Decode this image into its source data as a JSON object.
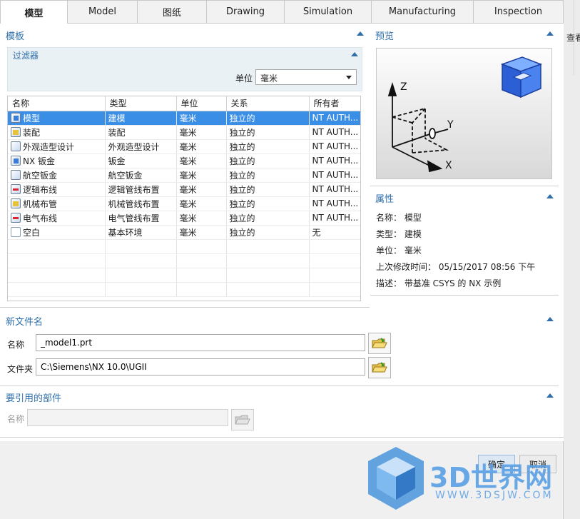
{
  "tabs": [
    "模型",
    "Model",
    "图纸",
    "Drawing",
    "Simulation",
    "Manufacturing",
    "Inspection"
  ],
  "right_strip_text": "查看",
  "templates": {
    "title": "模板",
    "filter": {
      "title": "过滤器",
      "unit_label": "单位",
      "unit_value": "毫米"
    },
    "columns": [
      "名称",
      "类型",
      "单位",
      "关系",
      "所有者"
    ],
    "rows": [
      {
        "name": "模型",
        "type": "建模",
        "unit": "毫米",
        "relation": "独立的",
        "owner": "NT AUTH...",
        "icon": "model-icon"
      },
      {
        "name": "装配",
        "type": "装配",
        "unit": "毫米",
        "relation": "独立的",
        "owner": "NT AUTH...",
        "icon": "assembly-icon"
      },
      {
        "name": "外观造型设计",
        "type": "外观造型设计",
        "unit": "毫米",
        "relation": "独立的",
        "owner": "NT AUTH...",
        "icon": "shape-studio-icon"
      },
      {
        "name": "NX 钣金",
        "type": "钣金",
        "unit": "毫米",
        "relation": "独立的",
        "owner": "NT AUTH...",
        "icon": "sheet-metal-icon"
      },
      {
        "name": "航空钣金",
        "type": "航空钣金",
        "unit": "毫米",
        "relation": "独立的",
        "owner": "NT AUTH...",
        "icon": "aero-sheet-metal-icon"
      },
      {
        "name": "逻辑布线",
        "type": "逻辑管线布置",
        "unit": "毫米",
        "relation": "独立的",
        "owner": "NT AUTH...",
        "icon": "logical-routing-icon"
      },
      {
        "name": "机械布管",
        "type": "机械管线布置",
        "unit": "毫米",
        "relation": "独立的",
        "owner": "NT AUTH...",
        "icon": "mechanical-routing-icon"
      },
      {
        "name": "电气布线",
        "type": "电气管线布置",
        "unit": "毫米",
        "relation": "独立的",
        "owner": "NT AUTH...",
        "icon": "electrical-routing-icon"
      },
      {
        "name": "空白",
        "type": "基本环境",
        "unit": "毫米",
        "relation": "独立的",
        "owner": "无",
        "icon": "blank-icon"
      }
    ]
  },
  "preview": {
    "title": "预览",
    "axis_z": "Z",
    "axis_y": "Y",
    "axis_x": "X"
  },
  "properties": {
    "title": "属性",
    "name_line": "名称： 模型",
    "type_line": "类型： 建模",
    "unit_line": "单位： 毫米",
    "modified_line": "上次修改时间： 05/15/2017 08:56 下午",
    "description_line": "描述： 带基准 CSYS 的 NX 示例"
  },
  "new_file": {
    "title": "新文件名",
    "name_label": "名称",
    "name_value": "_model1.prt",
    "folder_label": "文件夹",
    "folder_value": "C:\\Siemens\\NX 10.0\\UGII"
  },
  "referenced": {
    "title": "要引用的部件",
    "name_label": "名称",
    "name_value": ""
  },
  "buttons": {
    "ok": "确定",
    "cancel": "取消"
  },
  "watermark": {
    "brand": "3D世界网",
    "url": "WWW.3DSJW.COM"
  }
}
